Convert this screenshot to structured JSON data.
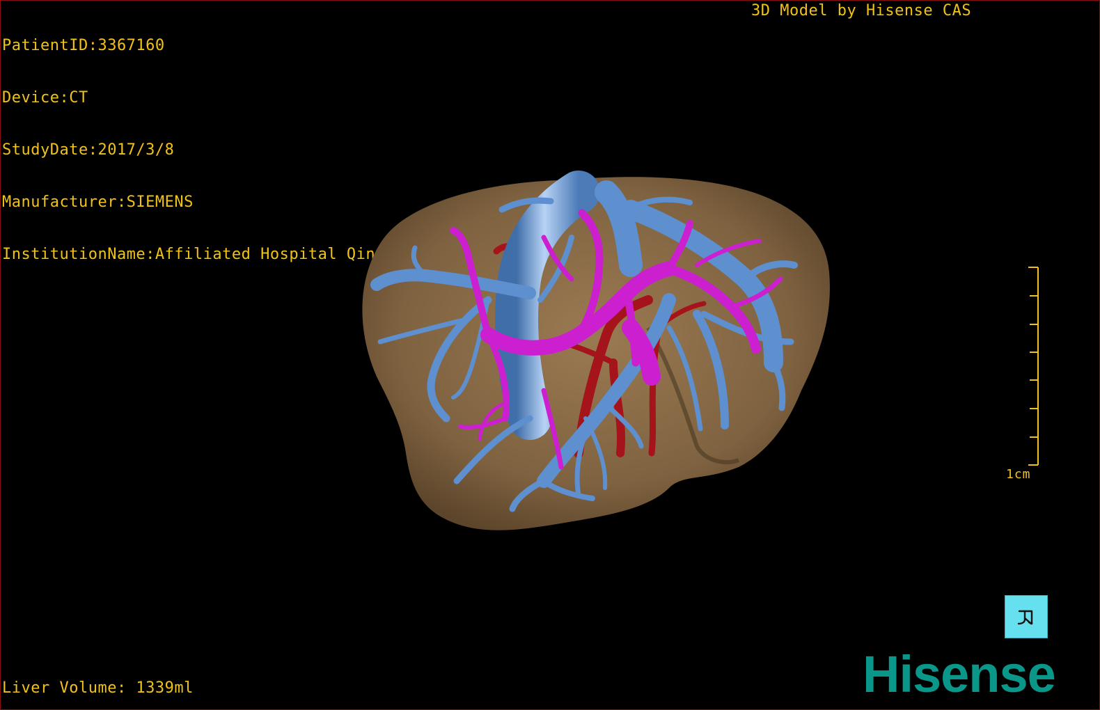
{
  "header": {
    "patient_id": "PatientID:3367160",
    "device": "Device:CT",
    "study_date": "StudyDate:2017/3/8",
    "manufacturer": "Manufacturer:SIEMENS",
    "institution": "InstitutionName:Affiliated Hospital Qingdao University-C"
  },
  "credit": "3D Model by Hisense CAS",
  "footer": {
    "liver_volume": "Liver Volume: 1339ml"
  },
  "scale_bar": {
    "label": "1cm"
  },
  "brand": {
    "name": "Hisense"
  },
  "orientation_button": {
    "icon": "orientation-icon"
  },
  "colors": {
    "overlay_text": "#f0c21a",
    "liver": "#8a6a44",
    "hepatic_vein": "#5e8fcf",
    "portal_vein": "#cc1fd0",
    "artery": "#a5131b",
    "brand": "#0a9688",
    "orientation_button": "#66e0ef"
  }
}
